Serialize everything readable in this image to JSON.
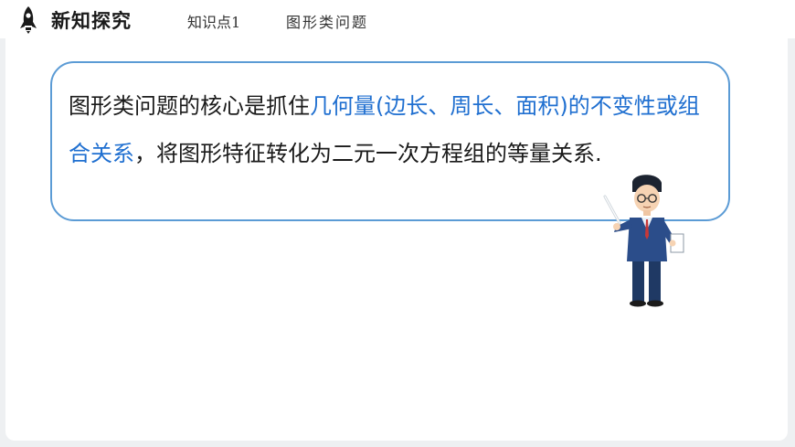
{
  "header": {
    "title": "新知探究",
    "knowledge_point": "知识点1",
    "topic": "图形类问题",
    "icon": "rocket-icon"
  },
  "bubble": {
    "part1": "图形类问题的核心是抓住",
    "highlight1": "几何量(边长、周长、面积)的",
    "highlight2": "不变性或组合关系",
    "part2": "，将图形特征转化为二元一次方程组",
    "part3": "的等量关系."
  },
  "colors": {
    "accent": "#5b9bd5",
    "highlight_text": "#1f6fd0",
    "background": "#eef0f2"
  },
  "illustration": "teacher-with-pointer"
}
